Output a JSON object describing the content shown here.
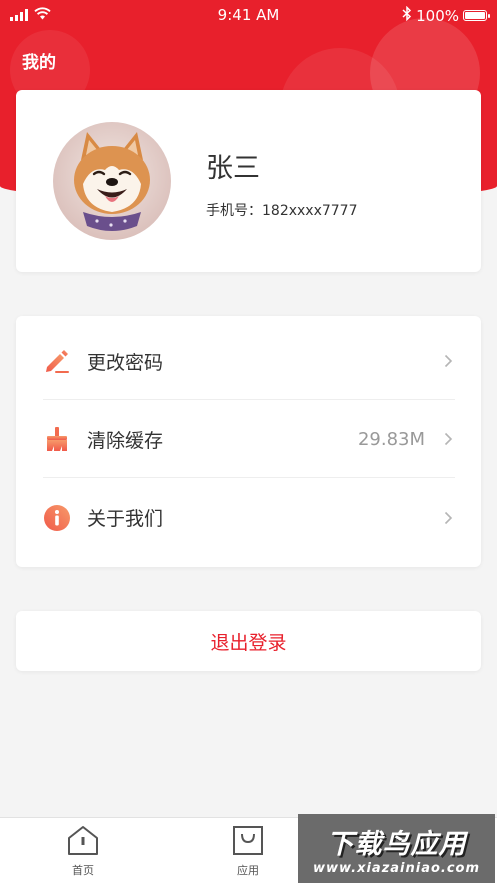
{
  "status_bar": {
    "time": "9:41 AM",
    "battery": "100%",
    "battery_level": 1.0,
    "icons": [
      "signal-icon",
      "wifi-icon",
      "bluetooth-icon",
      "battery-icon"
    ]
  },
  "header": {
    "title": "我的",
    "color": "#e8202c"
  },
  "profile": {
    "name": "张三",
    "phone_label": "手机号：",
    "phone": "182xxxx7777",
    "avatar_icon": "shiba-dog-avatar"
  },
  "menu": {
    "items": [
      {
        "label": "更改密码",
        "icon": "pencil-icon",
        "value": ""
      },
      {
        "label": "清除缓存",
        "icon": "broom-icon",
        "value": "29.83M"
      },
      {
        "label": "关于我们",
        "icon": "info-icon",
        "value": ""
      }
    ]
  },
  "logout": {
    "label": "退出登录"
  },
  "tab_bar": {
    "tabs": [
      {
        "label": "首页",
        "icon": "home-icon"
      },
      {
        "label": "应用",
        "icon": "bag-icon"
      }
    ]
  },
  "watermark": {
    "title": "下载鸟应用",
    "url": "www.xiazainiao.com"
  },
  "colors": {
    "accent": "#e8202c",
    "icon_orange": "#f26b4f",
    "background": "#f4f4f4"
  }
}
